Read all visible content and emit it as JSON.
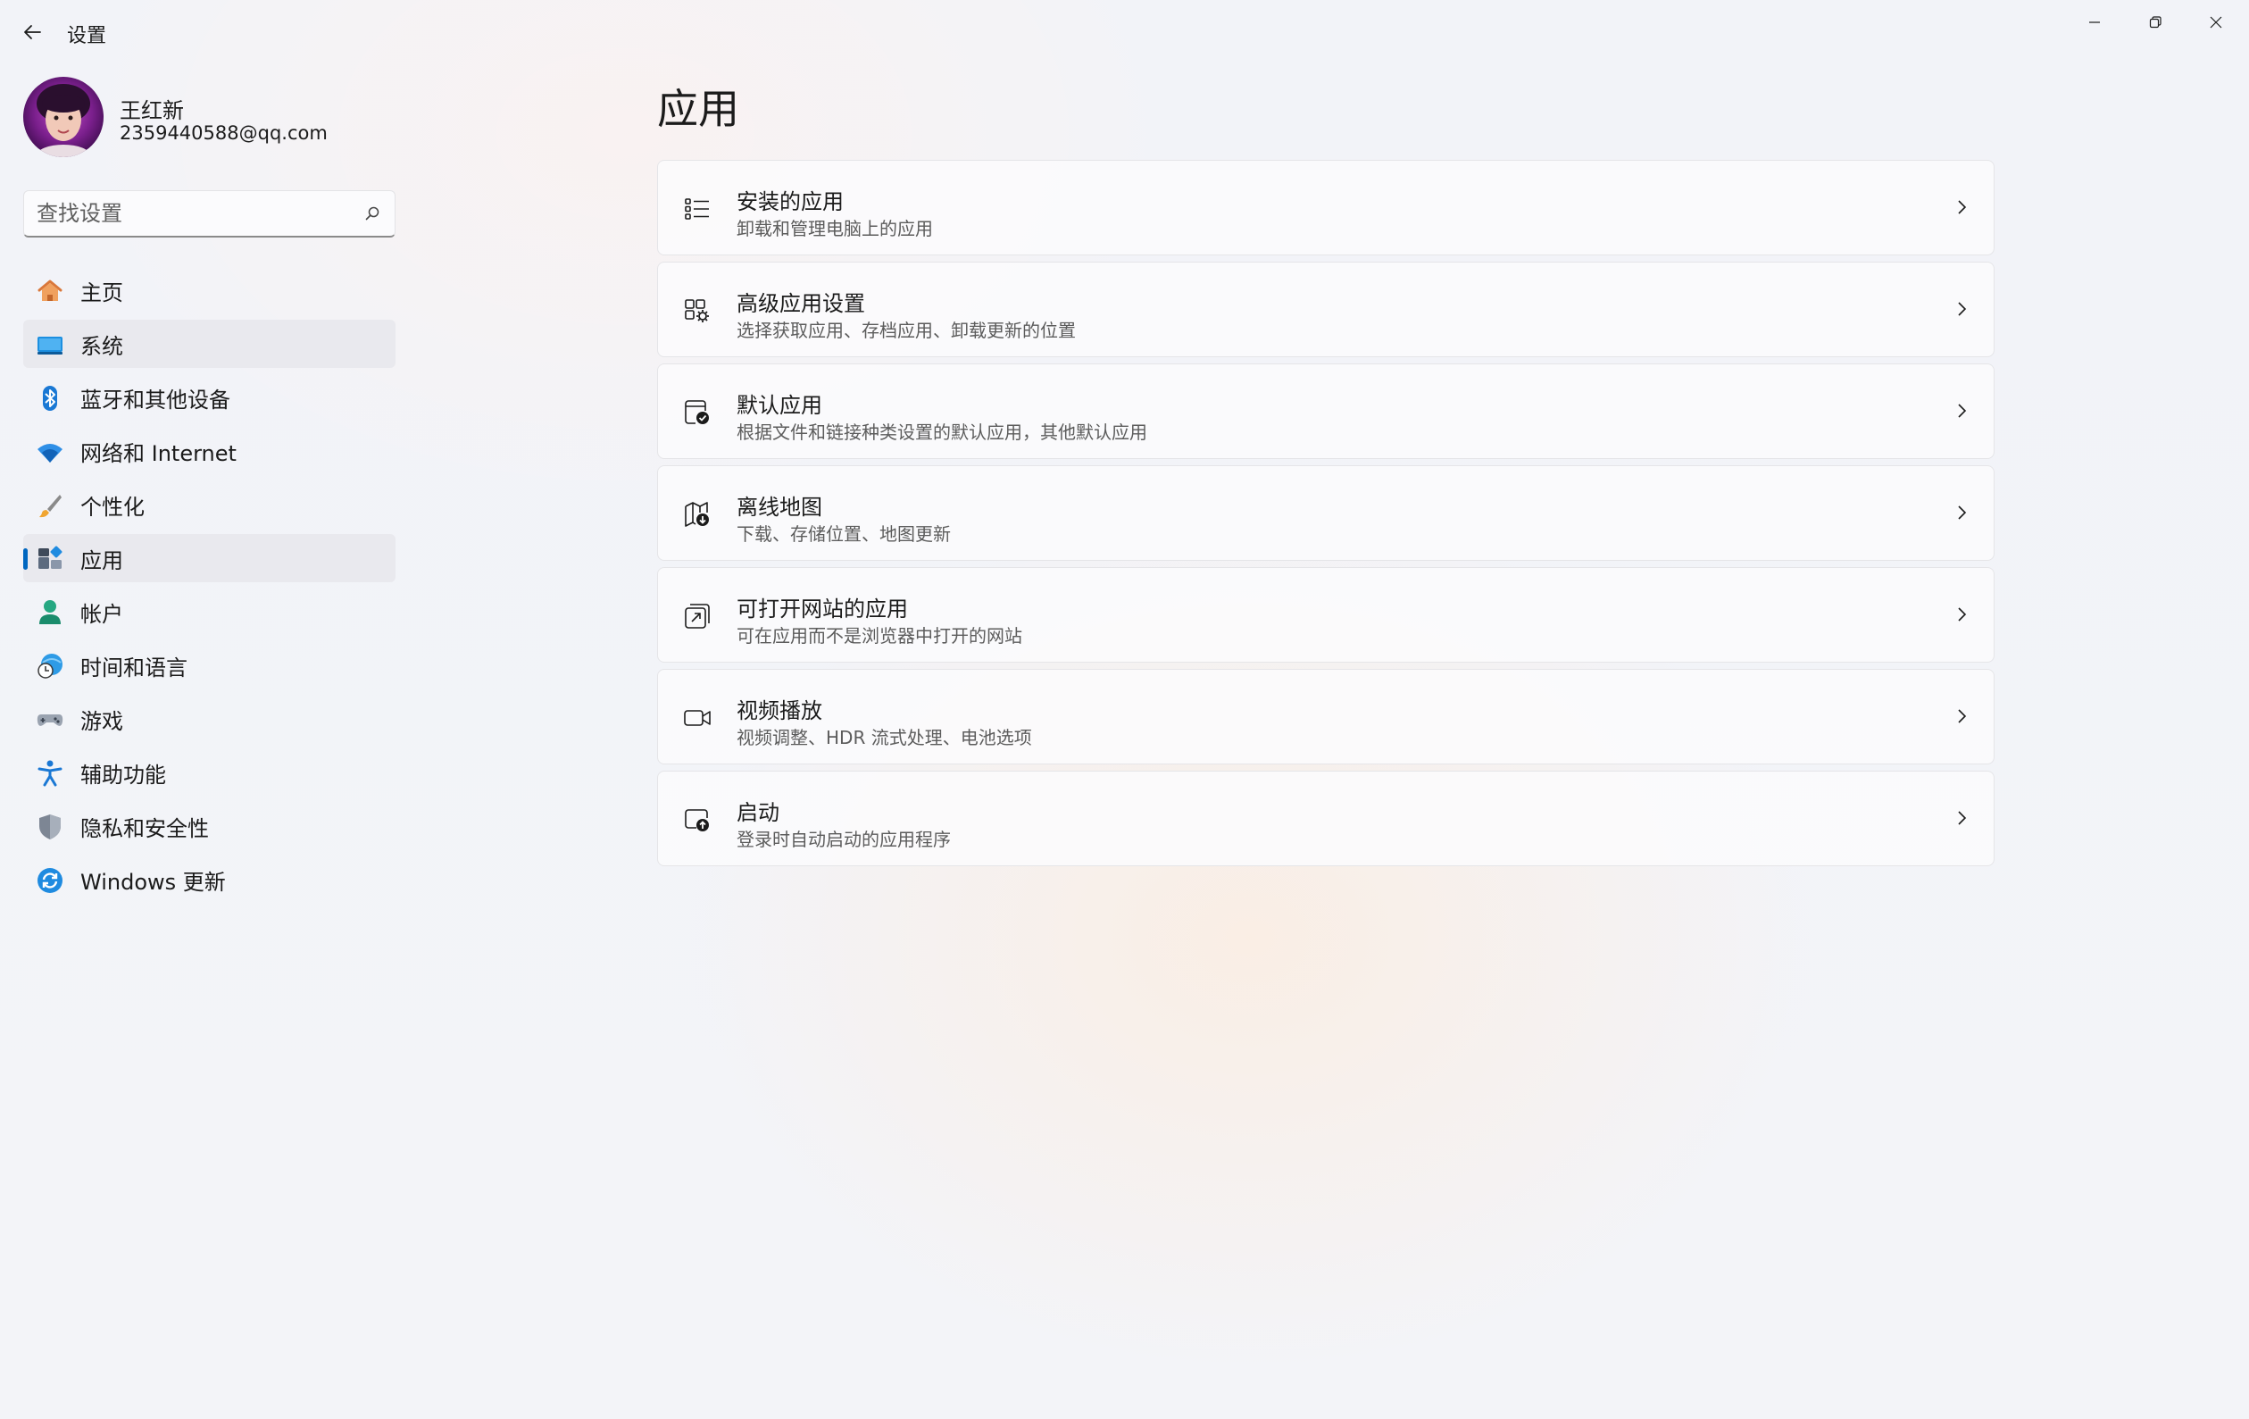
{
  "window": {
    "title": "设置",
    "minimize_icon": "minimize-icon",
    "maximize_icon": "restore-icon",
    "close_icon": "close-icon"
  },
  "profile": {
    "name": "王红新",
    "email": "2359440588@qq.com"
  },
  "search": {
    "placeholder": "查找设置",
    "value": ""
  },
  "sidebar": {
    "items": [
      {
        "label": "主页",
        "icon": "home-icon"
      },
      {
        "label": "系统",
        "icon": "system-icon"
      },
      {
        "label": "蓝牙和其他设备",
        "icon": "bluetooth-icon"
      },
      {
        "label": "网络和 Internet",
        "icon": "wifi-icon"
      },
      {
        "label": "个性化",
        "icon": "brush-icon"
      },
      {
        "label": "应用",
        "icon": "apps-icon",
        "selected": true
      },
      {
        "label": "帐户",
        "icon": "account-icon"
      },
      {
        "label": "时间和语言",
        "icon": "time-language-icon"
      },
      {
        "label": "游戏",
        "icon": "gaming-icon"
      },
      {
        "label": "辅助功能",
        "icon": "accessibility-icon"
      },
      {
        "label": "隐私和安全性",
        "icon": "shield-icon"
      },
      {
        "label": "Windows 更新",
        "icon": "windows-update-icon"
      }
    ]
  },
  "main": {
    "title": "应用",
    "cards": [
      {
        "title": "安装的应用",
        "subtitle": "卸载和管理电脑上的应用",
        "icon": "installed-apps-icon"
      },
      {
        "title": "高级应用设置",
        "subtitle": "选择获取应用、存档应用、卸载更新的位置",
        "icon": "advanced-app-settings-icon"
      },
      {
        "title": "默认应用",
        "subtitle": "根据文件和链接种类设置的默认应用，其他默认应用",
        "icon": "default-apps-icon"
      },
      {
        "title": "离线地图",
        "subtitle": "下载、存储位置、地图更新",
        "icon": "offline-maps-icon"
      },
      {
        "title": "可打开网站的应用",
        "subtitle": "可在应用而不是浏览器中打开的网站",
        "icon": "apps-for-websites-icon"
      },
      {
        "title": "视频播放",
        "subtitle": "视频调整、HDR 流式处理、电池选项",
        "icon": "video-playback-icon"
      },
      {
        "title": "启动",
        "subtitle": "登录时自动启动的应用程序",
        "icon": "startup-icon"
      }
    ]
  },
  "colors": {
    "accent": "#0067c0",
    "selected_bg": "#e9e9ee"
  }
}
